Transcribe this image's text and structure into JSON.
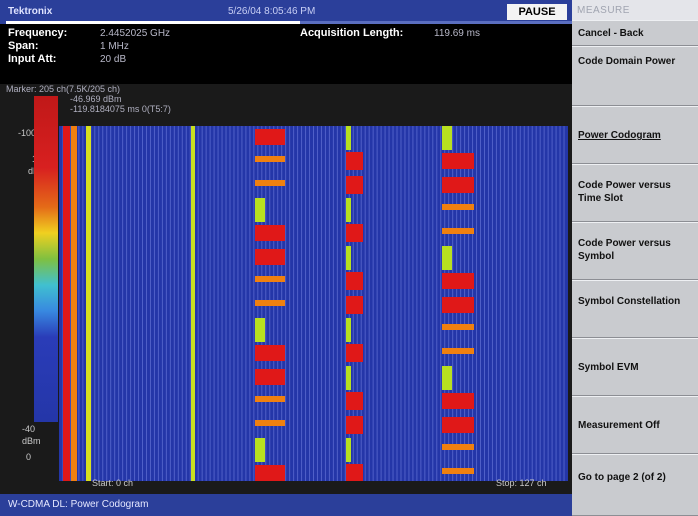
{
  "titlebar": {
    "brand": "Tektronix",
    "datetime": "5/26/04 8:05:46 PM",
    "pause_label": "PAUSE",
    "progress": 0.52
  },
  "info": {
    "frequency_label": "Frequency:",
    "frequency_value": "2.4452025 GHz",
    "span_label": "Span:",
    "span_value": "1 MHz",
    "input_att_label": "Input Att:",
    "input_att_value": "20 dB",
    "acq_label": "Acquisition Length:",
    "acq_value": "119.69 ms"
  },
  "marker": {
    "line1": "Marker: 205 ch(7.5K/205 ch)",
    "line2": "-46.969 dBm",
    "line3": "-119.8184075 ms  0(T5:7)"
  },
  "axis": {
    "top_value": "-100",
    "unit_top_1": "10",
    "unit_top_2": "dBm",
    "bottom_value": "-40",
    "unit_bottom": "dBm",
    "zero": "0",
    "start": "Start: 0 ch",
    "stop": "Stop: 127 ch"
  },
  "footer": {
    "title": "W-CDMA DL: Power Codogram"
  },
  "menu": {
    "title": "MEASURE",
    "items": [
      {
        "label": "Cancel - Back"
      },
      {
        "label": "Code Domain Power"
      },
      {
        "label": "Power Codogram"
      },
      {
        "label": "Code Power versus Time Slot"
      },
      {
        "label": "Code Power versus Symbol"
      },
      {
        "label": "Symbol Constellation"
      },
      {
        "label": "Symbol EVM"
      },
      {
        "label": "Measurement Off"
      },
      {
        "label": "Go to page 2 (of 2)"
      }
    ]
  },
  "colors": {
    "background": "#2436a8",
    "grid_line": "#5060c8",
    "hot": "#e01818",
    "mid": "#b8e020",
    "warm": "#f08010",
    "accent": "#2b3f9a"
  },
  "codogram": {
    "total_channels": 128,
    "static_columns": [
      {
        "name": "col-red-0",
        "color": "#e01818"
      },
      {
        "name": "col-orange-1",
        "color": "#f08010"
      },
      {
        "name": "col-yellow-3",
        "color": "#d8e020"
      },
      {
        "name": "col-yellow-37",
        "color": "#c8e020"
      }
    ],
    "burst_columns": [
      {
        "name": "burst-a"
      },
      {
        "name": "burst-b"
      },
      {
        "name": "burst-c"
      }
    ]
  }
}
